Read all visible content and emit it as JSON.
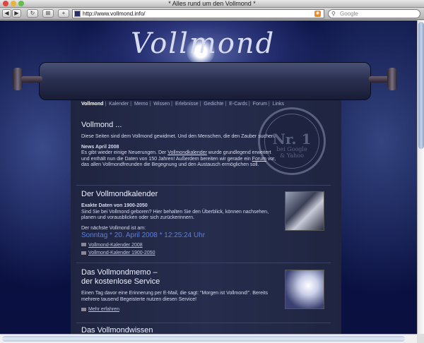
{
  "window": {
    "title": "* Alles rund um den Vollmond *"
  },
  "toolbar": {
    "back": "◀",
    "forward": "▶",
    "reload": "↻",
    "bookmark": "⊞",
    "add": "+",
    "url": "http://www.vollmond.info/",
    "search_placeholder": "Google"
  },
  "site": {
    "logo": "Vollmond"
  },
  "nav": {
    "items": [
      "Vollmond",
      "Kalender",
      "Memo",
      "Wissen",
      "Erlebnisse",
      "Gedichte",
      "E-Cards",
      "Forum",
      "Links"
    ]
  },
  "seal": {
    "number": "Nr. 1",
    "line1": "bei Google",
    "line2": "& Yahoo",
    "ring": "Vollmondseiten ~ Die bekanntesten"
  },
  "intro": {
    "title": "Vollmond ...",
    "text": "Diese Seiten sind dem Vollmond gewidmet. Und den Menschen, die den Zauber suchen.",
    "news_title": "News April 2008",
    "news_a": "Es gibt wieder einige Neuerungen. Der ",
    "news_link1": "Vollmondkalender",
    "news_b": " wurde grundlegend erweitert und enthält nun die Daten von 150 Jahren! Außerdem bereiten wir gerade ein ",
    "news_link2": "Forum",
    "news_c": " vor, das allen Vollmondfreunden die Begegnung und den Austausch ermöglichen soll."
  },
  "kalender": {
    "title": "Der Vollmondkalender",
    "subtitle": "Exakte Daten von 1900-2050",
    "text": "Sind Sie bei Vollmond geboren? Hier behalten Sie den Überblick, können nachsehen, planen und vorausblicken oder sich zurückerinnern.",
    "next_label": "Der nächste Vollmond ist am:",
    "next_date": "Sonntag * 20. April 2008 * 12:25:24 Uhr",
    "link1": "Vollmond-Kalender 2008",
    "link2": "Vollmond-Kalender 1900-2050"
  },
  "memo": {
    "title1": "Das Vollmondmemo –",
    "title2": "der kostenlose Service",
    "text": "Einen Tag davor eine Erinnerung per E-Mail, die sagt: \"Morgen ist Vollmond!\". Bereits mehrere tausend Begeisterte nutzen diesen Service!",
    "link": "Mehr erfahren"
  },
  "next_section": {
    "title": "Das Vollmondwissen"
  },
  "colors": {
    "background": "#0c1548",
    "paper": "#232a48",
    "accent_date": "#5a7fe0"
  }
}
